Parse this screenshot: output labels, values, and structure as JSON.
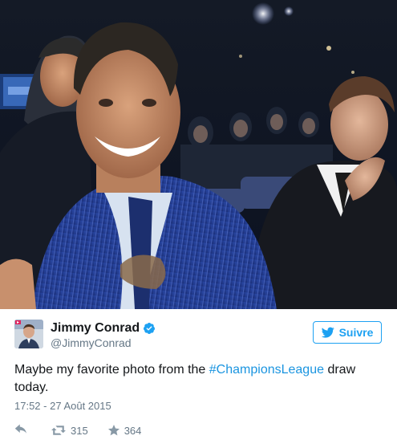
{
  "tweet": {
    "author": {
      "display_name": "Jimmy Conrad",
      "handle": "@JimmyConrad",
      "verified": true,
      "avatar_icon": "profile-photo"
    },
    "follow_button": {
      "label": "Suivre",
      "icon": "twitter-bird-icon"
    },
    "text": {
      "before": "Maybe my favorite photo from the ",
      "hashtag": "#ChampionsLeague",
      "after": " draw today."
    },
    "timestamp": "17:52 - 27 Août 2015",
    "actions": {
      "reply_icon": "reply-icon",
      "retweet_icon": "retweet-icon",
      "retweet_count": "315",
      "like_icon": "star-icon",
      "like_count": "364"
    },
    "colors": {
      "accent": "#1da1f2",
      "hashtag": "#1b95e0",
      "muted": "#657786",
      "text": "#14171a"
    }
  }
}
